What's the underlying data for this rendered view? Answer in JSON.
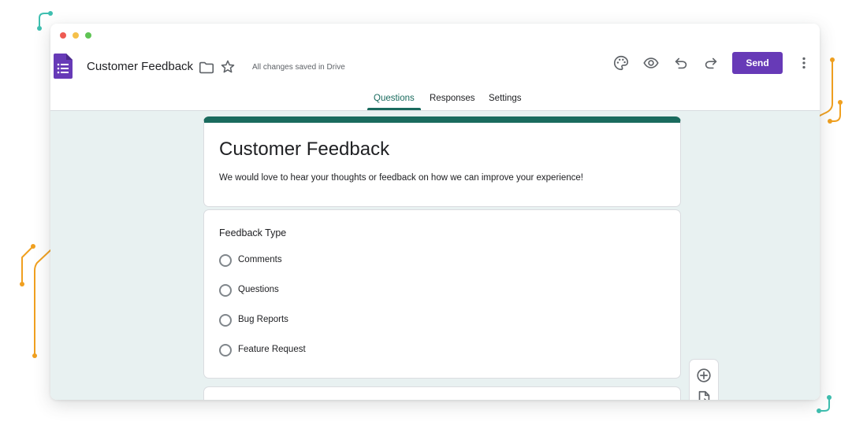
{
  "header": {
    "doc_title": "Customer Feedback",
    "saved_status": "All changes saved in Drive",
    "send_label": "Send",
    "icons": [
      "forms-logo-icon",
      "folder-icon",
      "star-icon",
      "palette-icon",
      "eye-icon",
      "undo-icon",
      "redo-icon",
      "more-vert-icon"
    ]
  },
  "tabs": [
    {
      "label": "Questions",
      "active": true
    },
    {
      "label": "Responses",
      "active": false
    },
    {
      "label": "Settings",
      "active": false
    }
  ],
  "form": {
    "title": "Customer Feedback",
    "description": "We would love to hear your thoughts or feedback on how we can improve your experience!"
  },
  "question": {
    "title": "Feedback Type",
    "options": [
      "Comments",
      "Questions",
      "Bug Reports",
      "Feature Request"
    ]
  },
  "side_toolbar": {
    "icons": [
      "add-circle-icon",
      "import-questions-icon"
    ]
  },
  "colors": {
    "accent": "#673ab7",
    "theme": "#1a6b5e",
    "canvas": "#e8f1f1",
    "decoration_orange": "#f0a020",
    "decoration_teal": "#3fbfb0"
  }
}
